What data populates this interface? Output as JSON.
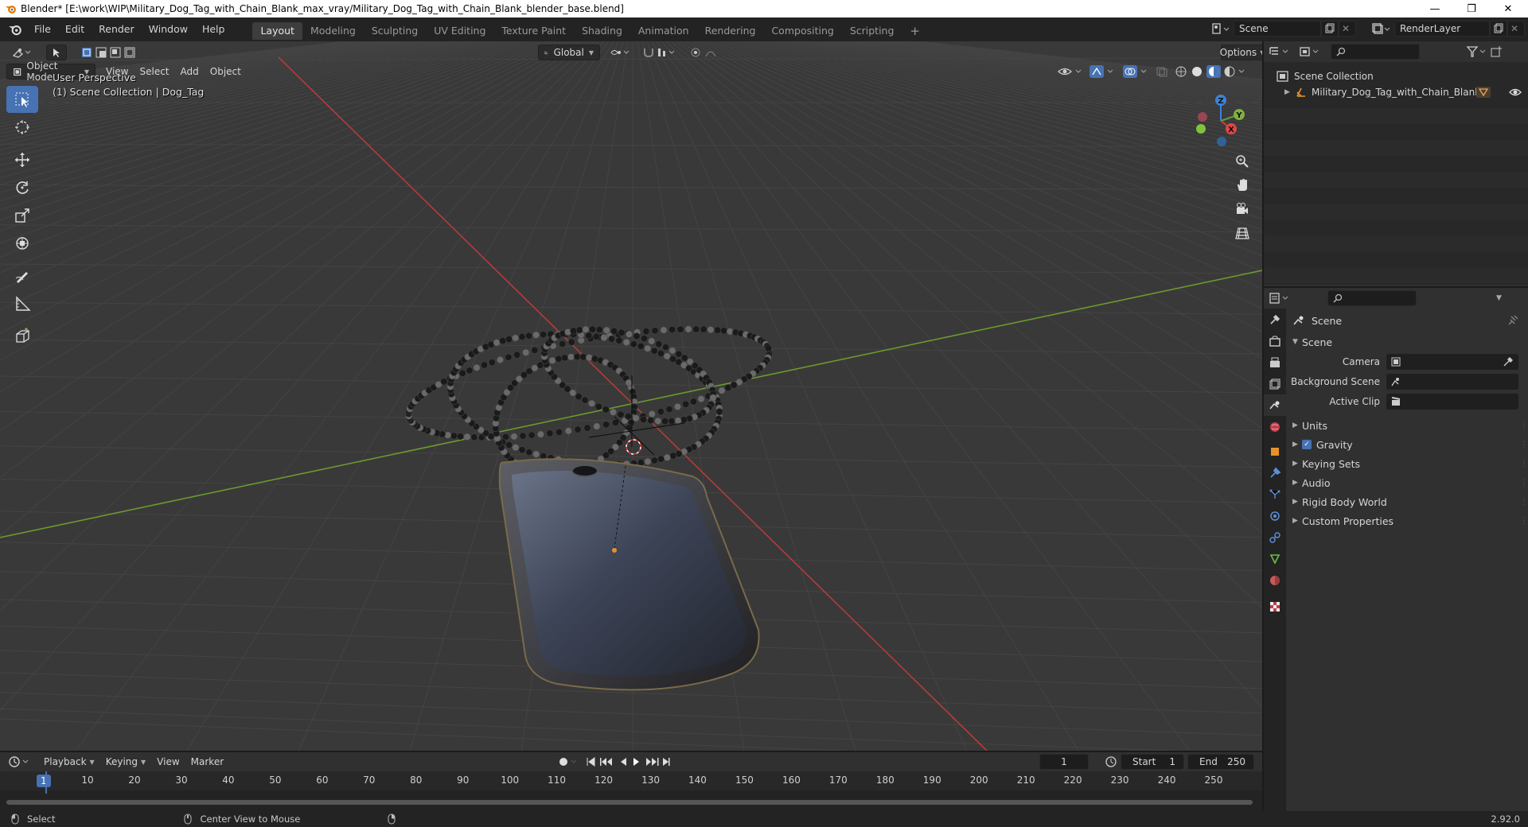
{
  "window": {
    "title": "Blender* [E:\\work\\WIP\\Military_Dog_Tag_with_Chain_Blank_max_vray/Military_Dog_Tag_with_Chain_Blank_blender_base.blend]",
    "minimize_glyph": "—",
    "restore_glyph": "❐",
    "close_glyph": "✕"
  },
  "menus": [
    "File",
    "Edit",
    "Render",
    "Window",
    "Help"
  ],
  "workspaces": [
    "Layout",
    "Modeling",
    "Sculpting",
    "UV Editing",
    "Texture Paint",
    "Shading",
    "Animation",
    "Rendering",
    "Compositing",
    "Scripting"
  ],
  "workspace_add": "+",
  "scene_field": "Scene",
  "render_layer_field": "RenderLayer",
  "viewport": {
    "transform_orientation": "Global",
    "options_label": "Options",
    "mode": "Object Mode",
    "menus": [
      "View",
      "Select",
      "Add",
      "Object"
    ],
    "overlay_perspective": "User Perspective",
    "overlay_collection": "(1) Scene Collection | Dog_Tag",
    "gizmo_labels": {
      "z": "Z",
      "y": "Y",
      "x": "X"
    }
  },
  "outliner": {
    "scene_collection": "Scene Collection",
    "object_name": "Military_Dog_Tag_with_Chain_Blank"
  },
  "properties": {
    "context": "Scene",
    "panel_title": "Scene",
    "fields": {
      "camera_label": "Camera",
      "background_scene_label": "Background Scene",
      "active_clip_label": "Active Clip"
    },
    "sections": [
      "Units",
      "Gravity",
      "Keying Sets",
      "Audio",
      "Rigid Body World",
      "Custom Properties"
    ],
    "gravity_checked": true
  },
  "timeline": {
    "menus": [
      "Playback",
      "Keying",
      "View",
      "Marker"
    ],
    "current_frame": "1",
    "start_label": "Start",
    "start_value": "1",
    "end_label": "End",
    "end_value": "250",
    "ruler": [
      "1",
      "10",
      "20",
      "30",
      "40",
      "50",
      "60",
      "70",
      "80",
      "90",
      "100",
      "110",
      "120",
      "130",
      "140",
      "150",
      "160",
      "170",
      "180",
      "190",
      "200",
      "210",
      "220",
      "230",
      "240",
      "250"
    ]
  },
  "statusbar": {
    "select": "Select",
    "center_view": "Center View to Mouse",
    "version": "2.92.0"
  },
  "colors": {
    "accent": "#4772b3",
    "x_axis": "#cc3333",
    "y_axis": "#7aa53a",
    "grid": "#444444"
  }
}
